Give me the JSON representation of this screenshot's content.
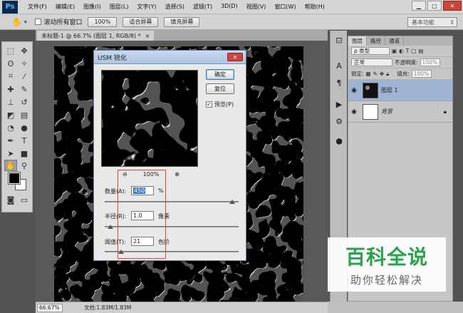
{
  "app": {
    "logo": "Ps"
  },
  "menu": [
    "文件(F)",
    "编辑(E)",
    "图像(I)",
    "图层(L)",
    "文字(Y)",
    "选择(S)",
    "滤镜(T)",
    "3D(D)",
    "视图(V)",
    "窗口(W)",
    "帮助(H)"
  ],
  "window_buttons": {
    "minimize": "▁",
    "restore": "▢",
    "close": "✕"
  },
  "options_bar": {
    "scroll_all_windows": "滚动所有窗口",
    "btn_100": "100%",
    "btn_fit": "适合屏幕",
    "btn_fill": "填充屏幕",
    "workspace": "基本功能"
  },
  "document": {
    "tab": "未标题-1 @ 66.7% (图层 1, RGB/8) *",
    "tab_close": "×"
  },
  "dialog": {
    "title": "USM 锐化",
    "ok": "确定",
    "reset": "复位",
    "preview_label": "预览(P)",
    "preview_checked": "✓",
    "zoom_level": "100%",
    "amount_label": "数量(A):",
    "amount_value": "450",
    "amount_unit": "%",
    "amount_fraction": 0.95,
    "radius_label": "半径(R):",
    "radius_value": "1.0",
    "radius_unit": "像素",
    "radius_fraction": 0.04,
    "threshold_label": "阈值(T):",
    "threshold_value": "21",
    "threshold_unit": "色阶",
    "threshold_fraction": 0.12
  },
  "layers_panel": {
    "tabs": [
      "图层",
      "路径",
      "通道"
    ],
    "filter_kind": "ρ 类型",
    "blend_mode": "正常",
    "opacity_label": "不透明度:",
    "opacity_value": "100%",
    "lock_label": "锁定:",
    "fill_label": "填充:",
    "fill_value": "100%",
    "layers": [
      {
        "name": "图层 1",
        "selected": true
      },
      {
        "name": "背景",
        "selected": false,
        "locked": true
      }
    ]
  },
  "status": {
    "zoom": "66.67%",
    "doc_info": "文档:1.83M/1.83M"
  },
  "watermark": {
    "main": "百科全说",
    "sub": "助你轻松解决"
  }
}
